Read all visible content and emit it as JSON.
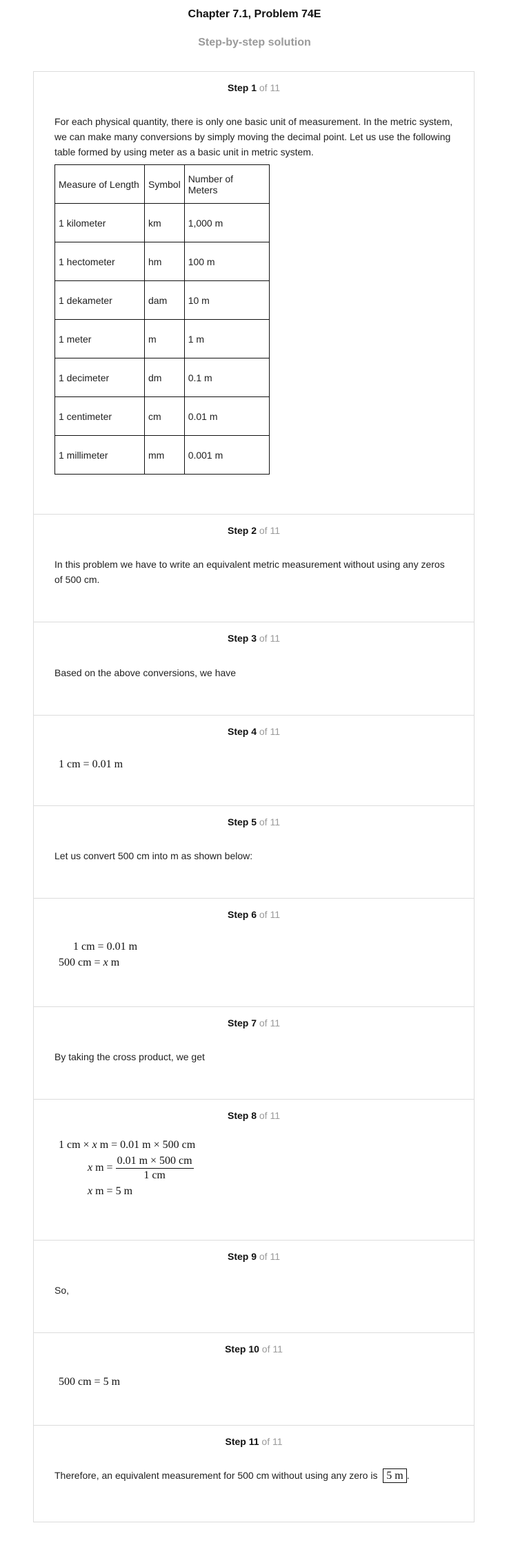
{
  "header": {
    "title": "Chapter 7.1, Problem 74E",
    "subtitle": "Step-by-step solution"
  },
  "step_of": "of 11",
  "steps": {
    "s1": {
      "label": "Step 1",
      "text": "For each physical quantity, there is only one basic unit of measurement. In the metric system, we can make many conversions by simply moving the decimal point. Let us use the following table formed by using meter as a basic unit in metric system.",
      "table": {
        "headers": [
          "Measure of Length",
          "Symbol",
          "Number of Meters"
        ],
        "rows": [
          [
            "1 kilometer",
            "km",
            "1,000 m"
          ],
          [
            "1 hectometer",
            "hm",
            "100 m"
          ],
          [
            "1 dekameter",
            "dam",
            "10 m"
          ],
          [
            "1 meter",
            "m",
            "1 m"
          ],
          [
            "1 decimeter",
            "dm",
            "0.1 m"
          ],
          [
            "1 centimeter",
            "cm",
            "0.01 m"
          ],
          [
            "1 millimeter",
            "mm",
            "0.001 m"
          ]
        ]
      }
    },
    "s2": {
      "label": "Step 2",
      "text": "In this problem we have to write an equivalent metric measurement without using any zeros of 500 cm."
    },
    "s3": {
      "label": "Step 3",
      "text": "Based on the above conversions, we have"
    },
    "s4": {
      "label": "Step 4",
      "eq": "1 cm = 0.01 m"
    },
    "s5": {
      "label": "Step 5",
      "text": "Let us convert 500 cm into m as shown below:"
    },
    "s6": {
      "label": "Step 6",
      "line1": "1 cm = 0.01 m",
      "line2_a": "500 cm = ",
      "line2_var": "x",
      "line2_b": " m"
    },
    "s7": {
      "label": "Step 7",
      "text": "By taking the cross product, we get"
    },
    "s8": {
      "label": "Step 8",
      "line1_a": "1 cm × ",
      "line1_var": "x",
      "line1_b": " m = 0.01 m × 500 cm",
      "line2_var": "x",
      "line2_a": " m = ",
      "line2_num": "0.01 m × 500 cm",
      "line2_den": "1 cm",
      "line3_var": "x",
      "line3_a": " m = 5 m"
    },
    "s9": {
      "label": "Step 9",
      "text": "So,"
    },
    "s10": {
      "label": "Step 10",
      "eq": "500 cm = 5 m"
    },
    "s11": {
      "label": "Step 11",
      "text": "Therefore, an equivalent measurement for 500 cm without using any zero is",
      "answer": "5 m",
      "end": "."
    }
  }
}
